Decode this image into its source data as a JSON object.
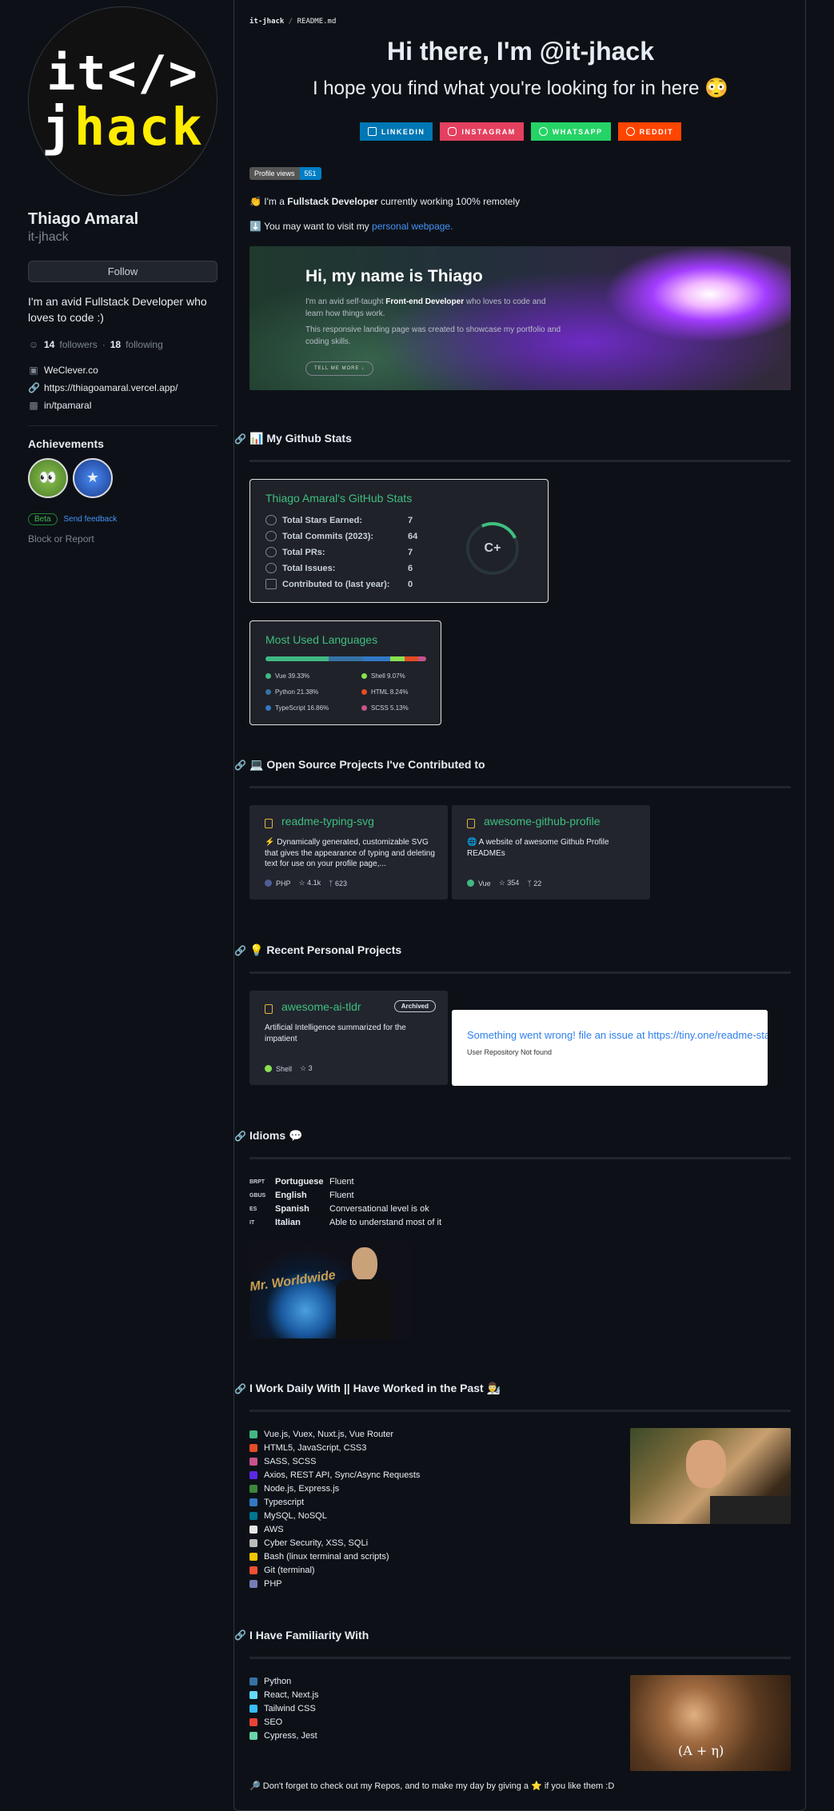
{
  "profile": {
    "avatar_line1": "it</>",
    "avatar_line2_a": "j",
    "avatar_line2_b": "hack",
    "name": "Thiago Amaral",
    "login": "it-jhack",
    "follow_label": "Follow",
    "bio": "I'm an avid Fullstack Developer who loves to code :)",
    "followers_count": "14",
    "followers_label": "followers",
    "dot": "·",
    "following_count": "18",
    "following_label": "following",
    "company": "WeClever.co",
    "website": "https://thiagoamaral.vercel.app/",
    "linkedin": "in/tpamaral",
    "achievements_title": "Achievements",
    "beta_label": "Beta",
    "feedback_label": "Send feedback",
    "block_label": "Block or Report"
  },
  "readme": {
    "breadcrumb_repo": "it-jhack",
    "breadcrumb_sep": "/",
    "breadcrumb_file": "README.md",
    "title": "Hi there, I'm @it-jhack",
    "subtitle": "I hope you find what you're looking for in here 😳",
    "socials": [
      {
        "label": "LINKEDIN",
        "color": "#0077b5"
      },
      {
        "label": "INSTAGRAM",
        "color": "#e4405f"
      },
      {
        "label": "WHATSAPP",
        "color": "#25d366"
      },
      {
        "label": "REDDIT",
        "color": "#ff4500"
      }
    ],
    "profile_views_label": "Profile views",
    "profile_views_value": "551",
    "intro_emoji": "👏",
    "intro_a": "I'm a",
    "intro_b": "Fullstack Developer",
    "intro_c": "currently working 100% remotely",
    "visit_emoji": "⬇️",
    "visit_a": "You may want to visit my",
    "visit_link": "personal webpage.",
    "banner": {
      "title": "Hi, my name is Thiago",
      "p1_a": "I'm an avid self-taught",
      "p1_b": "Front-end Developer",
      "p1_c": "who loves to code and learn how things work.",
      "p2": "This responsive landing page was created to showcase my portfolio and coding skills.",
      "button": "TELL ME MORE ↓"
    },
    "sec_stats": "📊 My Github Stats",
    "stats": {
      "title": "Thiago Amaral's GitHub Stats",
      "rows": [
        {
          "label": "Total Stars Earned:",
          "value": "7"
        },
        {
          "label": "Total Commits (2023):",
          "value": "64"
        },
        {
          "label": "Total PRs:",
          "value": "7"
        },
        {
          "label": "Total Issues:",
          "value": "6"
        },
        {
          "label": "Contributed to (last year):",
          "value": "0"
        }
      ],
      "grade": "C+"
    },
    "langs": {
      "title": "Most Used Languages",
      "items": [
        {
          "name": "Vue 39.33%",
          "pct": 39.33,
          "color": "#41b883"
        },
        {
          "name": "Python 21.38%",
          "pct": 21.38,
          "color": "#3572a5"
        },
        {
          "name": "TypeScript 16.86%",
          "pct": 16.86,
          "color": "#3178c6"
        },
        {
          "name": "Shell 9.07%",
          "pct": 9.07,
          "color": "#89e051"
        },
        {
          "name": "HTML 8.24%",
          "pct": 8.24,
          "color": "#e34c26"
        },
        {
          "name": "SCSS 5.13%",
          "pct": 5.13,
          "color": "#c6538c"
        }
      ]
    },
    "sec_oss": "💻 Open Source Projects I've Contributed to",
    "oss": [
      {
        "name": "readme-typing-svg",
        "desc": "⚡ Dynamically generated, customizable SVG that gives the appearance of typing and deleting text for use on your profile page,...",
        "lang": "PHP",
        "lang_color": "#4f5d95",
        "stars": "4.1k",
        "forks": "623"
      },
      {
        "name": "awesome-github-profile",
        "desc": "🌐 A website of awesome Github Profile READMEs",
        "lang": "Vue",
        "lang_color": "#41b883",
        "stars": "354",
        "forks": "22"
      }
    ],
    "sec_personal": "💡 Recent Personal Projects",
    "personal": {
      "name": "awesome-ai-tldr",
      "archived": "Archived",
      "desc": "Artificial Intelligence summarized for the impatient",
      "lang": "Shell",
      "lang_color": "#89e051",
      "stars": "3"
    },
    "error": {
      "title": "Something went wrong! file an issue at https://tiny.one/readme-stats",
      "detail": "User Repository Not found"
    },
    "sec_idioms": "Idioms 💬",
    "idioms": [
      {
        "code": "BRPT",
        "lang": "Portuguese",
        "level": "Fluent"
      },
      {
        "code": "GBUS",
        "lang": "English",
        "level": "Fluent"
      },
      {
        "code": "ES",
        "lang": "Spanish",
        "level": "Conversational level is ok"
      },
      {
        "code": "IT",
        "lang": "Italian",
        "level": "Able to understand most of it"
      }
    ],
    "meme1_text": "Mr. Worldwide",
    "sec_daily": "I Work Daily With  ||  Have Worked in the Past 👨‍🔬",
    "daily": [
      {
        "label": "Vue.js, Vuex, Nuxt.js, Vue Router",
        "color": "#41b883"
      },
      {
        "label": "HTML5, JavaScript, CSS3",
        "color": "#e34c26"
      },
      {
        "label": "SASS, SCSS",
        "color": "#c6538c"
      },
      {
        "label": "Axios, REST API, Sync/Async Requests",
        "color": "#5a29e4"
      },
      {
        "label": "Node.js, Express.js",
        "color": "#3c873a"
      },
      {
        "label": "Typescript",
        "color": "#3178c6"
      },
      {
        "label": "MySQL, NoSQL",
        "color": "#00758f"
      },
      {
        "label": "AWS",
        "color": "#e6e6e6"
      },
      {
        "label": "Cyber Security, XSS, SQLi",
        "color": "#bbbbbb"
      },
      {
        "label": "Bash (linux terminal and scripts)",
        "color": "#f0c400"
      },
      {
        "label": "Git (terminal)",
        "color": "#f05032"
      },
      {
        "label": "PHP",
        "color": "#777bb4"
      }
    ],
    "sec_familiar": "I Have Familiarity With",
    "familiar": [
      {
        "label": "Python",
        "color": "#3572a5"
      },
      {
        "label": "React, Next.js",
        "color": "#61dafb"
      },
      {
        "label": "Tailwind CSS",
        "color": "#38bdf8"
      },
      {
        "label": "SEO",
        "color": "#ea4335"
      },
      {
        "label": "Cypress, Jest",
        "color": "#69d3a7"
      }
    ],
    "meme3_text": "(A + η)",
    "closing_a": "🔎 Don't forget to check out my Repos, and to make my day by giving a",
    "closing_star": "⭐",
    "closing_b": "if you like them :D"
  }
}
